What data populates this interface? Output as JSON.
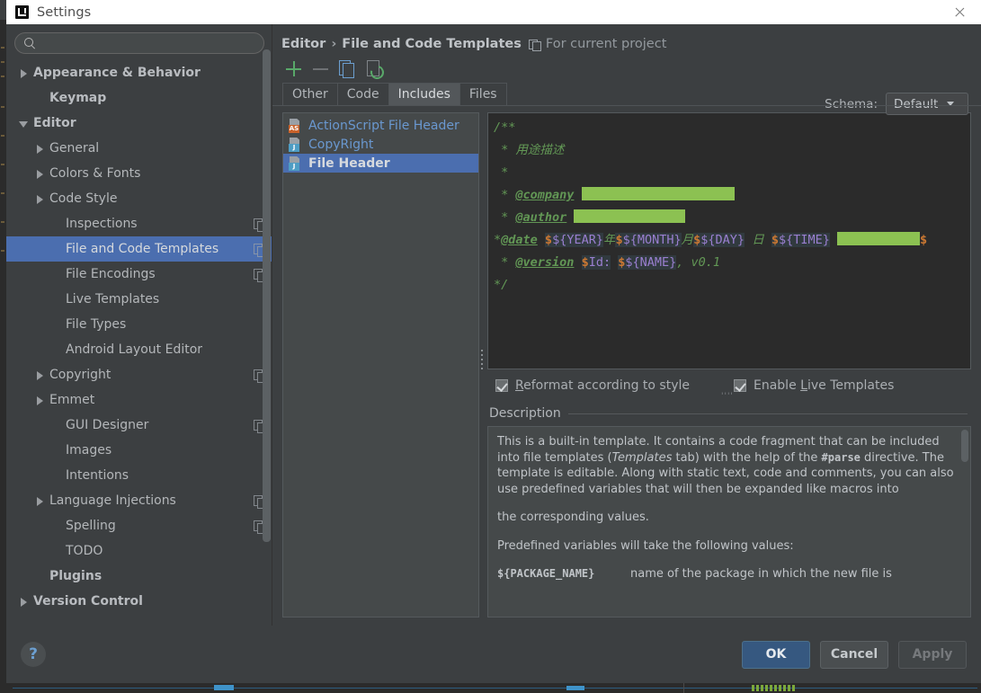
{
  "window": {
    "title": "Settings",
    "logo_icon": "intellij-logo",
    "close_icon": "close-icon"
  },
  "search": {
    "value": "",
    "placeholder": "",
    "icon": "search-icon"
  },
  "sidebar": {
    "items": [
      {
        "label": "Appearance & Behavior",
        "arrow": "right",
        "bold": true,
        "indent": 0,
        "copy": false,
        "selected": false
      },
      {
        "label": "Keymap",
        "arrow": "none",
        "bold": true,
        "indent": 1,
        "copy": false,
        "selected": false
      },
      {
        "label": "Editor",
        "arrow": "down",
        "bold": true,
        "indent": 0,
        "copy": false,
        "selected": false
      },
      {
        "label": "General",
        "arrow": "right",
        "bold": false,
        "indent": 1,
        "copy": false,
        "selected": false
      },
      {
        "label": "Colors & Fonts",
        "arrow": "right",
        "bold": false,
        "indent": 1,
        "copy": false,
        "selected": false
      },
      {
        "label": "Code Style",
        "arrow": "right",
        "bold": false,
        "indent": 1,
        "copy": false,
        "selected": false
      },
      {
        "label": "Inspections",
        "arrow": "none",
        "bold": false,
        "indent": 2,
        "copy": true,
        "selected": false
      },
      {
        "label": "File and Code Templates",
        "arrow": "none",
        "bold": false,
        "indent": 2,
        "copy": true,
        "selected": true
      },
      {
        "label": "File Encodings",
        "arrow": "none",
        "bold": false,
        "indent": 2,
        "copy": true,
        "selected": false
      },
      {
        "label": "Live Templates",
        "arrow": "none",
        "bold": false,
        "indent": 2,
        "copy": false,
        "selected": false
      },
      {
        "label": "File Types",
        "arrow": "none",
        "bold": false,
        "indent": 2,
        "copy": false,
        "selected": false
      },
      {
        "label": "Android Layout Editor",
        "arrow": "none",
        "bold": false,
        "indent": 2,
        "copy": false,
        "selected": false
      },
      {
        "label": "Copyright",
        "arrow": "right",
        "bold": false,
        "indent": 1,
        "copy": true,
        "selected": false
      },
      {
        "label": "Emmet",
        "arrow": "right",
        "bold": false,
        "indent": 1,
        "copy": false,
        "selected": false
      },
      {
        "label": "GUI Designer",
        "arrow": "none",
        "bold": false,
        "indent": 2,
        "copy": true,
        "selected": false
      },
      {
        "label": "Images",
        "arrow": "none",
        "bold": false,
        "indent": 2,
        "copy": false,
        "selected": false
      },
      {
        "label": "Intentions",
        "arrow": "none",
        "bold": false,
        "indent": 2,
        "copy": false,
        "selected": false
      },
      {
        "label": "Language Injections",
        "arrow": "right",
        "bold": false,
        "indent": 1,
        "copy": true,
        "selected": false
      },
      {
        "label": "Spelling",
        "arrow": "none",
        "bold": false,
        "indent": 2,
        "copy": true,
        "selected": false
      },
      {
        "label": "TODO",
        "arrow": "none",
        "bold": false,
        "indent": 2,
        "copy": false,
        "selected": false
      },
      {
        "label": "Plugins",
        "arrow": "none",
        "bold": true,
        "indent": 1,
        "copy": false,
        "selected": false
      },
      {
        "label": "Version Control",
        "arrow": "right",
        "bold": true,
        "indent": 0,
        "copy": false,
        "selected": false
      }
    ]
  },
  "breadcrumb": {
    "root": "Editor",
    "separator": "›",
    "current": "File and Code Templates",
    "scope_icon": "project-scope-icon",
    "scope_label": "For current project"
  },
  "toolbar": {
    "add_icon": "plus-icon",
    "remove_icon": "minus-icon",
    "copy_icon": "copy-icon",
    "reset_icon": "reset-icon"
  },
  "schema": {
    "label": "Schema:",
    "value": "Default",
    "caret_icon": "chevron-down-icon"
  },
  "tabs": [
    {
      "label": "Files",
      "active": false
    },
    {
      "label": "Includes",
      "active": true
    },
    {
      "label": "Code",
      "active": false
    },
    {
      "label": "Other",
      "active": false
    }
  ],
  "template_list": [
    {
      "label": "ActionScript File Header",
      "badge": "AS",
      "badge_color": "#c8622b",
      "selected": false
    },
    {
      "label": "CopyRight",
      "badge": "J",
      "badge_color": "#4e9dc4",
      "selected": false
    },
    {
      "label": "File Header",
      "badge": "J",
      "badge_color": "#4e9dc4",
      "selected": true
    }
  ],
  "editor": {
    "lines": [
      {
        "id": "l1",
        "text": "/**"
      },
      {
        "id": "l2",
        "text": " * 用途描述"
      },
      {
        "id": "l3",
        "text": " *"
      },
      {
        "id": "l4",
        "text": " * @company [redacted]"
      },
      {
        "id": "l5",
        "text": " * @author [redacted]"
      },
      {
        "id": "l6",
        "text": "*@date ${YEAR}年${MONTH}月${DAY}日 ${TIME} [redacted] $"
      },
      {
        "id": "l7",
        "text": " * @version $Id: ${NAME}, v0.1"
      },
      {
        "id": "l8",
        "text": " */"
      }
    ],
    "l1": "/**",
    "l2_star": " * ",
    "l2_text": "用途描述",
    "l3": " *",
    "l4_star": " * ",
    "l4_tag": "@company",
    "l5_star": " * ",
    "l5_tag": "@author",
    "l6_star": "*",
    "l6_tag": "@date",
    "l6_year": "${YEAR}",
    "l6_cn_year": "年",
    "l6_month": "${MONTH}",
    "l6_cn_month": "月",
    "l6_day": "${DAY}",
    "l6_cn_day": "日",
    "l6_time": "${TIME}",
    "l6_tail": "$",
    "l7_star": " * ",
    "l7_tag": "@version",
    "l7_id": "$Id:",
    "l7_name": "${NAME}",
    "l7_ver": ", v0.1",
    "l8": "*/"
  },
  "checkboxes": {
    "reformat": {
      "label_u": "R",
      "label_rest": "eformat according to style",
      "checked": true,
      "enabled": false
    },
    "live": {
      "label_a": "Enable ",
      "label_u": "L",
      "label_rest": "ive Templates",
      "checked": true,
      "enabled": true
    }
  },
  "description": {
    "title": "Description",
    "p1_a": "This is a built-in template. It contains a code fragment that can be included into file templates (",
    "p1_i": "Templates",
    "p1_b": " tab) with the help of the ",
    "p1_mono": "#parse",
    "p1_c": " directive. The template is editable. Along with static text, code and comments, you can also use predefined variables that will then be expanded like macros into",
    "p2": "the corresponding values.",
    "p3": "Predefined variables will take the following values:",
    "row_key": "${PACKAGE_NAME}",
    "row_val": "name of the package in which the new file is"
  },
  "footer": {
    "help_icon": "help-icon",
    "help_label": "?",
    "ok": "OK",
    "cancel": "Cancel",
    "apply": "Apply"
  }
}
